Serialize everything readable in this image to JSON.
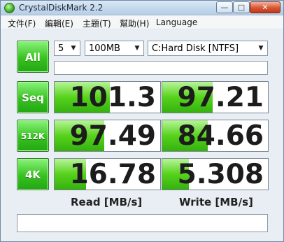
{
  "window": {
    "title": "CrystalDiskMark 2.2",
    "min_symbol": "—",
    "max_symbol": "□",
    "close_symbol": "✕"
  },
  "menu": [
    "文件(F)",
    "編輯(E)",
    "主題(T)",
    "幫助(H)",
    "Language"
  ],
  "controls": {
    "all_label": "All",
    "runs": "5",
    "size": "100MB",
    "drive": "C:Hard Disk [NTFS]"
  },
  "tests": [
    {
      "label": "Seq",
      "read": "101.3",
      "write": "97.21",
      "read_frac": 0.52,
      "write_frac": 0.48
    },
    {
      "label": "512K",
      "read": "97.49",
      "write": "84.66",
      "read_frac": 0.47,
      "write_frac": 0.43
    },
    {
      "label": "4K",
      "read": "16.78",
      "write": "5.308",
      "read_frac": 0.3,
      "write_frac": 0.25
    }
  ],
  "columns": {
    "read": "Read [MB/s]",
    "write": "Write [MB/s]"
  },
  "colors": {
    "accent_green": "#37c21f"
  }
}
